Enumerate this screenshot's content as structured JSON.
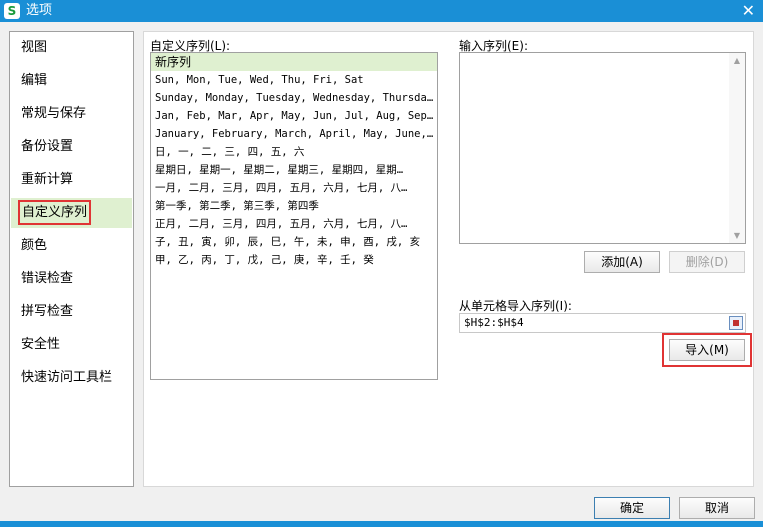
{
  "window": {
    "title": "选项",
    "app_icon": "S"
  },
  "sidebar": {
    "items": [
      {
        "label": "视图"
      },
      {
        "label": "编辑"
      },
      {
        "label": "常规与保存"
      },
      {
        "label": "备份设置"
      },
      {
        "label": "重新计算"
      },
      {
        "label": "自定义序列",
        "selected": true
      },
      {
        "label": "颜色"
      },
      {
        "label": "错误检查"
      },
      {
        "label": "拼写检查"
      },
      {
        "label": "安全性"
      },
      {
        "label": "快速访问工具栏"
      }
    ]
  },
  "custom_lists": {
    "label": "自定义序列(L):",
    "items": [
      "新序列",
      "Sun, Mon, Tue, Wed, Thu, Fri, Sat",
      "Sunday, Monday, Tuesday, Wednesday, Thursday…",
      "Jan, Feb, Mar, Apr, May, Jun, Jul, Aug, Sep,…",
      "January, February, March, April, May, June, …",
      "日, 一, 二, 三, 四, 五, 六",
      "星期日, 星期一, 星期二, 星期三, 星期四, 星期…",
      "一月, 二月, 三月, 四月, 五月, 六月, 七月, 八…",
      "第一季, 第二季, 第三季, 第四季",
      "正月, 二月, 三月, 四月, 五月, 六月, 七月, 八…",
      "子, 丑, 寅, 卯, 辰, 巳, 午, 未, 申, 酉, 戌, 亥",
      "甲, 乙, 丙, 丁, 戊, 己, 庚, 辛, 壬, 癸"
    ]
  },
  "input_list": {
    "label": "输入序列(E):",
    "value": ""
  },
  "buttons": {
    "add": "添加(A)",
    "delete": "删除(D)",
    "import": "导入(M)",
    "ok": "确定",
    "cancel": "取消"
  },
  "import_range": {
    "label": "从单元格导入序列(I):",
    "value": "$H$2:$H$4"
  },
  "colors": {
    "accent": "#1a8fd6",
    "highlight": "#e03434",
    "selection": "#dff0d0"
  }
}
